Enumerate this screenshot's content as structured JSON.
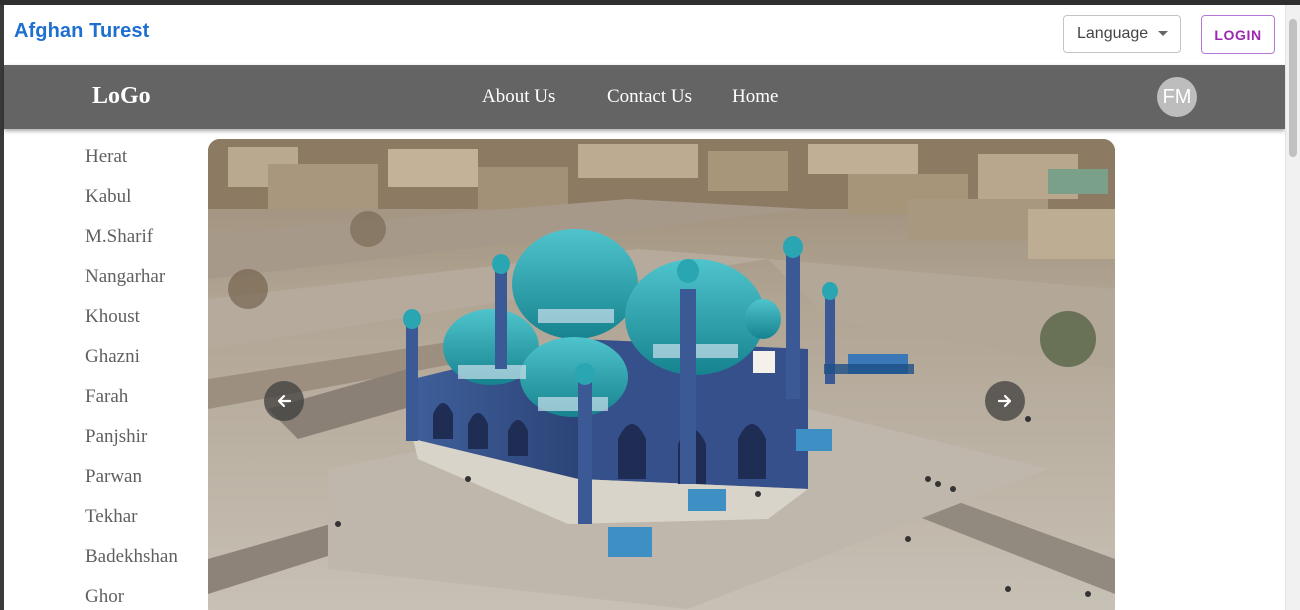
{
  "header": {
    "brand": "Afghan Turest",
    "language_label": "Language",
    "login_label": "LOGIN"
  },
  "navbar": {
    "logo": "LoGo",
    "links": [
      "About Us",
      "Contact Us",
      "Home"
    ],
    "avatar_initials": "FM"
  },
  "sidebar": {
    "items": [
      "Herat",
      "Kabul",
      "M.Sharif",
      "Nangarhar",
      "Khoust",
      "Ghazni",
      "Farah",
      "Panjshir",
      "Parwan",
      "Tekhar",
      "Badekhshan",
      "Ghor"
    ]
  },
  "carousel": {
    "prev_icon": "arrow-left-icon",
    "next_icon": "arrow-right-icon"
  },
  "colors": {
    "brand": "#1e6fcf",
    "navbar": "#646464",
    "login": "#9c27b0",
    "avatar": "#bdbdbd"
  }
}
